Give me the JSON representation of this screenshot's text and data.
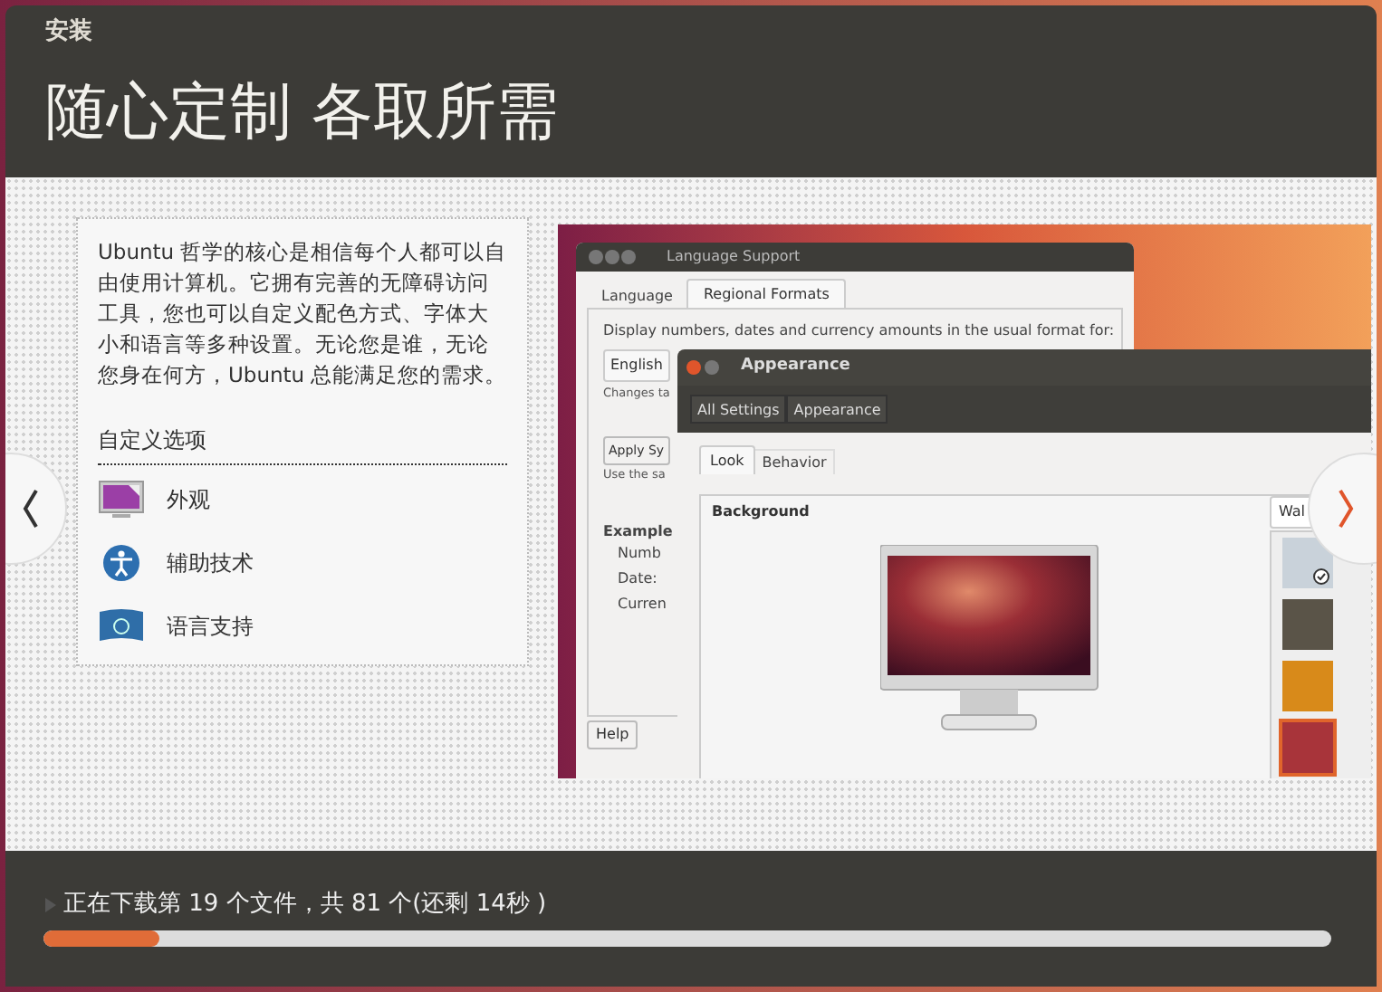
{
  "window": {
    "title": "安装"
  },
  "heading": "随心定制 各取所需",
  "description": "Ubuntu 哲学的核心是相信每个人都可以自由使用计算机。它拥有完善的无障碍访问工具，您也可以自定义配色方式、字体大小和语言等多种设置。无论您是谁，无论您身在何方，Ubuntu 总能满足您的需求。",
  "options": {
    "title": "自定义选项",
    "items": [
      {
        "kind": "appearance",
        "label": "外观"
      },
      {
        "kind": "accessibility",
        "label": "辅助技术"
      },
      {
        "kind": "language",
        "label": "语言支持"
      }
    ]
  },
  "screenshot": {
    "language_window": {
      "title": "Language Support",
      "tabs": [
        {
          "label": "Language",
          "selected": false
        },
        {
          "label": "Regional Formats",
          "selected": true
        }
      ],
      "prompt": "Display numbers, dates and currency amounts in the usual format for:",
      "dropdown": "English",
      "note_1": "Changes ta",
      "button_1": "Apply Sy",
      "note_2": "Use the sa",
      "example_title": "Example",
      "example_rows": [
        "Numb",
        "Date:",
        "Curren"
      ],
      "help_button": "Help"
    },
    "appearance_window": {
      "title": "Appearance",
      "breadcrumbs": [
        "All Settings",
        "Appearance"
      ],
      "tabs": [
        {
          "label": "Look",
          "selected": true
        },
        {
          "label": "Behavior",
          "selected": false
        }
      ],
      "section": "Background",
      "wallpaper_dropdown": "Wal",
      "thumbnails": [
        {
          "selected": false,
          "checked": true
        },
        {
          "selected": false,
          "checked": false
        },
        {
          "selected": false,
          "checked": false
        },
        {
          "selected": true,
          "checked": false
        }
      ]
    }
  },
  "status": {
    "text": "正在下载第 19 个文件，共 81 个(还剩 14秒 )",
    "level": 0.09
  }
}
